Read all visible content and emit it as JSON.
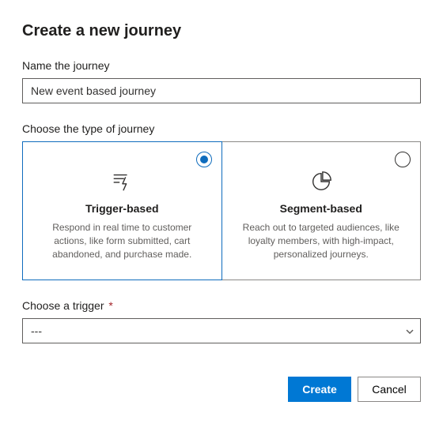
{
  "header": {
    "title": "Create a new journey"
  },
  "name_field": {
    "label": "Name the journey",
    "value": "New event based journey"
  },
  "type_field": {
    "label": "Choose the type of journey",
    "options": [
      {
        "key": "trigger",
        "title": "Trigger-based",
        "description": "Respond in real time to customer actions, like form submitted, cart abandoned, and purchase made.",
        "selected": true
      },
      {
        "key": "segment",
        "title": "Segment-based",
        "description": "Reach out to targeted audiences, like loyalty members, with high-impact, personalized journeys.",
        "selected": false
      }
    ]
  },
  "trigger_field": {
    "label": "Choose a trigger",
    "required_mark": "*",
    "value": "---"
  },
  "footer": {
    "create": "Create",
    "cancel": "Cancel"
  }
}
